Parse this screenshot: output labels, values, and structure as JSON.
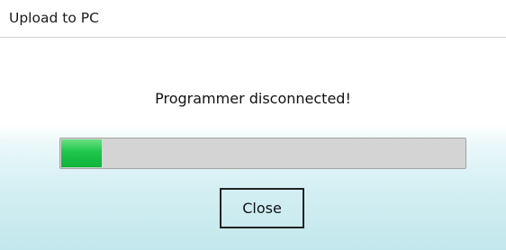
{
  "dialog": {
    "title": "Upload to PC",
    "message": "Programmer disconnected!",
    "progress": {
      "fraction": 0.1
    },
    "close_label": "Close"
  },
  "colors": {
    "progress_fill": "#1ec64a",
    "progress_track": "#d4d4d4",
    "background_gradient_bottom": "#c2e7ec"
  }
}
